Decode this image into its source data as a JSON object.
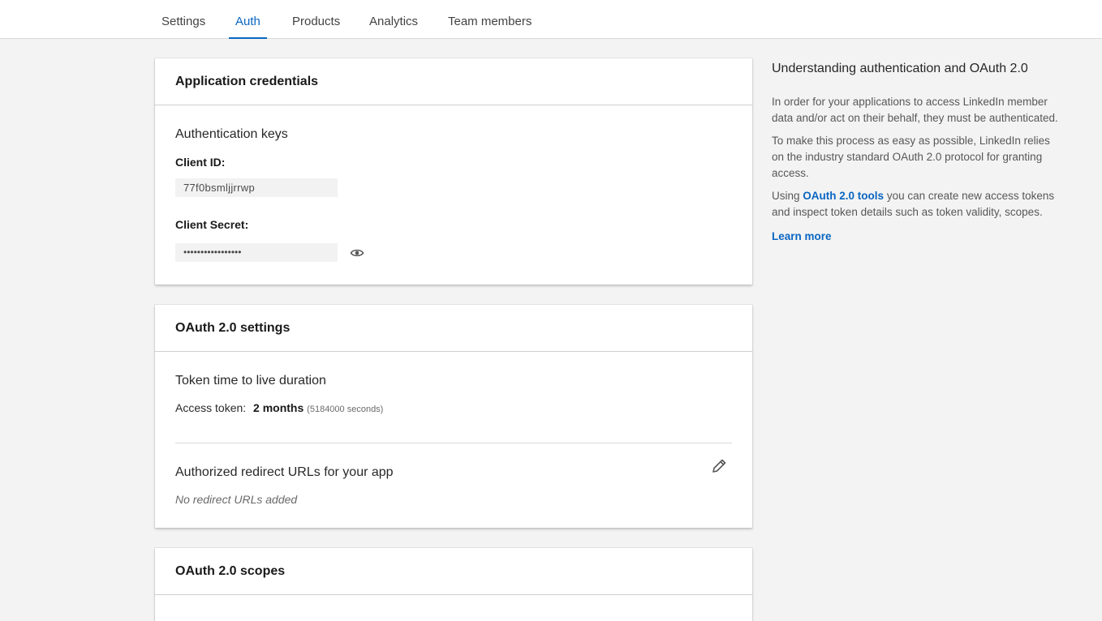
{
  "tabs": [
    {
      "label": "Settings",
      "active": false
    },
    {
      "label": "Auth",
      "active": true
    },
    {
      "label": "Products",
      "active": false
    },
    {
      "label": "Analytics",
      "active": false
    },
    {
      "label": "Team members",
      "active": false
    }
  ],
  "credentials": {
    "title": "Application credentials",
    "keys_heading": "Authentication keys",
    "client_id_label": "Client ID:",
    "client_id_value": "77f0bsmljjrrwp",
    "client_secret_label": "Client Secret:",
    "client_secret_value": "•••••••••••••••••",
    "reveal_icon": "eye-icon"
  },
  "oauth_settings": {
    "title": "OAuth 2.0 settings",
    "ttl_heading": "Token time to live duration",
    "access_token_label": "Access token:",
    "access_token_value": "2 months",
    "access_token_seconds": "(5184000 seconds)",
    "redirect_heading": "Authorized redirect URLs for your app",
    "redirect_empty": "No redirect URLs added",
    "edit_icon": "pencil-icon"
  },
  "oauth_scopes": {
    "title": "OAuth 2.0 scopes"
  },
  "sidebar": {
    "title": "Understanding authentication and OAuth 2.0",
    "para1": "In order for your applications to access LinkedIn member data and/or act on their behalf, they must be authenticated.",
    "para2": "To make this process as easy as possible, LinkedIn relies on the industry standard OAuth 2.0 protocol for granting access.",
    "para3_prefix": "Using",
    "para3_link": "OAuth 2.0 tools",
    "para3_suffix": "you can create new access tokens and inspect token details such as token validity, scopes.",
    "learn_more": "Learn more"
  },
  "colors": {
    "accent": "#0a66c2",
    "background": "#f3f3f3"
  }
}
